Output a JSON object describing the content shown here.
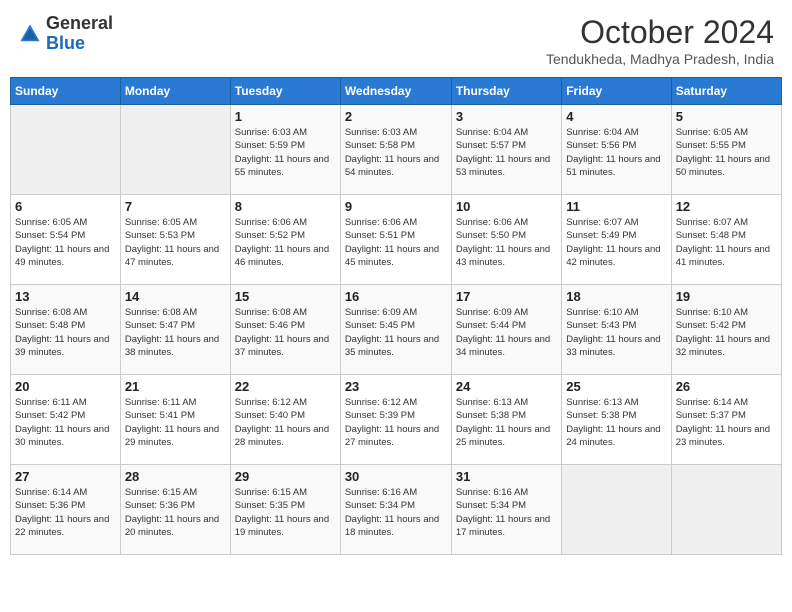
{
  "header": {
    "logo_general": "General",
    "logo_blue": "Blue",
    "month_title": "October 2024",
    "location": "Tendukheda, Madhya Pradesh, India"
  },
  "days_of_week": [
    "Sunday",
    "Monday",
    "Tuesday",
    "Wednesday",
    "Thursday",
    "Friday",
    "Saturday"
  ],
  "weeks": [
    [
      {
        "day": "",
        "sunrise": "",
        "sunset": "",
        "daylight": ""
      },
      {
        "day": "",
        "sunrise": "",
        "sunset": "",
        "daylight": ""
      },
      {
        "day": "1",
        "sunrise": "Sunrise: 6:03 AM",
        "sunset": "Sunset: 5:59 PM",
        "daylight": "Daylight: 11 hours and 55 minutes."
      },
      {
        "day": "2",
        "sunrise": "Sunrise: 6:03 AM",
        "sunset": "Sunset: 5:58 PM",
        "daylight": "Daylight: 11 hours and 54 minutes."
      },
      {
        "day": "3",
        "sunrise": "Sunrise: 6:04 AM",
        "sunset": "Sunset: 5:57 PM",
        "daylight": "Daylight: 11 hours and 53 minutes."
      },
      {
        "day": "4",
        "sunrise": "Sunrise: 6:04 AM",
        "sunset": "Sunset: 5:56 PM",
        "daylight": "Daylight: 11 hours and 51 minutes."
      },
      {
        "day": "5",
        "sunrise": "Sunrise: 6:05 AM",
        "sunset": "Sunset: 5:55 PM",
        "daylight": "Daylight: 11 hours and 50 minutes."
      }
    ],
    [
      {
        "day": "6",
        "sunrise": "Sunrise: 6:05 AM",
        "sunset": "Sunset: 5:54 PM",
        "daylight": "Daylight: 11 hours and 49 minutes."
      },
      {
        "day": "7",
        "sunrise": "Sunrise: 6:05 AM",
        "sunset": "Sunset: 5:53 PM",
        "daylight": "Daylight: 11 hours and 47 minutes."
      },
      {
        "day": "8",
        "sunrise": "Sunrise: 6:06 AM",
        "sunset": "Sunset: 5:52 PM",
        "daylight": "Daylight: 11 hours and 46 minutes."
      },
      {
        "day": "9",
        "sunrise": "Sunrise: 6:06 AM",
        "sunset": "Sunset: 5:51 PM",
        "daylight": "Daylight: 11 hours and 45 minutes."
      },
      {
        "day": "10",
        "sunrise": "Sunrise: 6:06 AM",
        "sunset": "Sunset: 5:50 PM",
        "daylight": "Daylight: 11 hours and 43 minutes."
      },
      {
        "day": "11",
        "sunrise": "Sunrise: 6:07 AM",
        "sunset": "Sunset: 5:49 PM",
        "daylight": "Daylight: 11 hours and 42 minutes."
      },
      {
        "day": "12",
        "sunrise": "Sunrise: 6:07 AM",
        "sunset": "Sunset: 5:48 PM",
        "daylight": "Daylight: 11 hours and 41 minutes."
      }
    ],
    [
      {
        "day": "13",
        "sunrise": "Sunrise: 6:08 AM",
        "sunset": "Sunset: 5:48 PM",
        "daylight": "Daylight: 11 hours and 39 minutes."
      },
      {
        "day": "14",
        "sunrise": "Sunrise: 6:08 AM",
        "sunset": "Sunset: 5:47 PM",
        "daylight": "Daylight: 11 hours and 38 minutes."
      },
      {
        "day": "15",
        "sunrise": "Sunrise: 6:08 AM",
        "sunset": "Sunset: 5:46 PM",
        "daylight": "Daylight: 11 hours and 37 minutes."
      },
      {
        "day": "16",
        "sunrise": "Sunrise: 6:09 AM",
        "sunset": "Sunset: 5:45 PM",
        "daylight": "Daylight: 11 hours and 35 minutes."
      },
      {
        "day": "17",
        "sunrise": "Sunrise: 6:09 AM",
        "sunset": "Sunset: 5:44 PM",
        "daylight": "Daylight: 11 hours and 34 minutes."
      },
      {
        "day": "18",
        "sunrise": "Sunrise: 6:10 AM",
        "sunset": "Sunset: 5:43 PM",
        "daylight": "Daylight: 11 hours and 33 minutes."
      },
      {
        "day": "19",
        "sunrise": "Sunrise: 6:10 AM",
        "sunset": "Sunset: 5:42 PM",
        "daylight": "Daylight: 11 hours and 32 minutes."
      }
    ],
    [
      {
        "day": "20",
        "sunrise": "Sunrise: 6:11 AM",
        "sunset": "Sunset: 5:42 PM",
        "daylight": "Daylight: 11 hours and 30 minutes."
      },
      {
        "day": "21",
        "sunrise": "Sunrise: 6:11 AM",
        "sunset": "Sunset: 5:41 PM",
        "daylight": "Daylight: 11 hours and 29 minutes."
      },
      {
        "day": "22",
        "sunrise": "Sunrise: 6:12 AM",
        "sunset": "Sunset: 5:40 PM",
        "daylight": "Daylight: 11 hours and 28 minutes."
      },
      {
        "day": "23",
        "sunrise": "Sunrise: 6:12 AM",
        "sunset": "Sunset: 5:39 PM",
        "daylight": "Daylight: 11 hours and 27 minutes."
      },
      {
        "day": "24",
        "sunrise": "Sunrise: 6:13 AM",
        "sunset": "Sunset: 5:38 PM",
        "daylight": "Daylight: 11 hours and 25 minutes."
      },
      {
        "day": "25",
        "sunrise": "Sunrise: 6:13 AM",
        "sunset": "Sunset: 5:38 PM",
        "daylight": "Daylight: 11 hours and 24 minutes."
      },
      {
        "day": "26",
        "sunrise": "Sunrise: 6:14 AM",
        "sunset": "Sunset: 5:37 PM",
        "daylight": "Daylight: 11 hours and 23 minutes."
      }
    ],
    [
      {
        "day": "27",
        "sunrise": "Sunrise: 6:14 AM",
        "sunset": "Sunset: 5:36 PM",
        "daylight": "Daylight: 11 hours and 22 minutes."
      },
      {
        "day": "28",
        "sunrise": "Sunrise: 6:15 AM",
        "sunset": "Sunset: 5:36 PM",
        "daylight": "Daylight: 11 hours and 20 minutes."
      },
      {
        "day": "29",
        "sunrise": "Sunrise: 6:15 AM",
        "sunset": "Sunset: 5:35 PM",
        "daylight": "Daylight: 11 hours and 19 minutes."
      },
      {
        "day": "30",
        "sunrise": "Sunrise: 6:16 AM",
        "sunset": "Sunset: 5:34 PM",
        "daylight": "Daylight: 11 hours and 18 minutes."
      },
      {
        "day": "31",
        "sunrise": "Sunrise: 6:16 AM",
        "sunset": "Sunset: 5:34 PM",
        "daylight": "Daylight: 11 hours and 17 minutes."
      },
      {
        "day": "",
        "sunrise": "",
        "sunset": "",
        "daylight": ""
      },
      {
        "day": "",
        "sunrise": "",
        "sunset": "",
        "daylight": ""
      }
    ]
  ]
}
